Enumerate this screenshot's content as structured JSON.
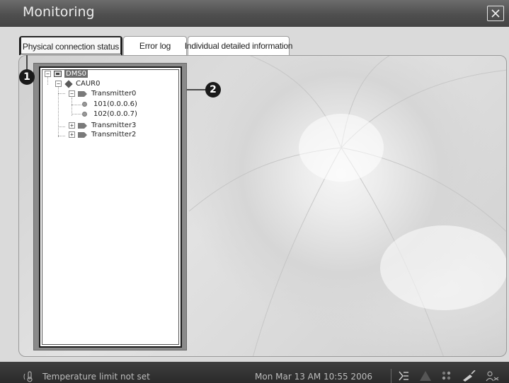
{
  "window": {
    "title": "Monitoring",
    "close_icon": "close-icon"
  },
  "tabs": [
    {
      "label": "Physical connection status",
      "active": true
    },
    {
      "label": "Error log",
      "active": false
    },
    {
      "label": "Individual detailed information",
      "active": false
    }
  ],
  "tree": {
    "nodes": [
      {
        "label": "DMS0",
        "icon": "server-icon",
        "selected": true
      },
      {
        "label": "CAUR0",
        "icon": "diamond-icon"
      },
      {
        "label": "Transmitter0",
        "icon": "transmitter-icon"
      },
      {
        "label": "101(0.0.0.6)",
        "icon": "device-dot-icon"
      },
      {
        "label": "102(0.0.0.7)",
        "icon": "device-dot-icon"
      },
      {
        "label": "Transmitter3",
        "icon": "transmitter-icon"
      },
      {
        "label": "Transmitter2",
        "icon": "transmitter-icon"
      }
    ]
  },
  "callouts": [
    "1",
    "2"
  ],
  "status_bar": {
    "message": "Temperature limit not set",
    "datetime": "Mon Mar 13 AM 10:55 2006"
  },
  "colors": {
    "titlebar": "#555555",
    "statusbar": "#333333",
    "tree_selection": "#6d6d6d"
  }
}
